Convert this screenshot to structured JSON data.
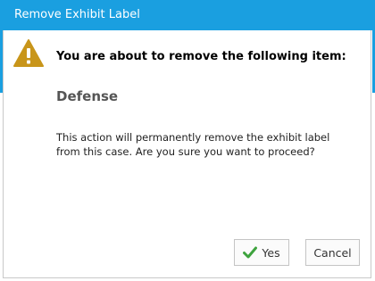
{
  "dialog": {
    "title": "Remove Exhibit Label",
    "headline": "You are about to remove the following item:",
    "item_name": "Defense",
    "message": "This action will permanently remove the exhibit label from this case.  Are you sure you want to proceed?",
    "icon": "warning-icon",
    "accent_color": "#1a9fe0",
    "warning_color": "#c8951a",
    "confirm_color": "#3ea33e"
  },
  "buttons": {
    "yes_label": "Yes",
    "cancel_label": "Cancel"
  }
}
